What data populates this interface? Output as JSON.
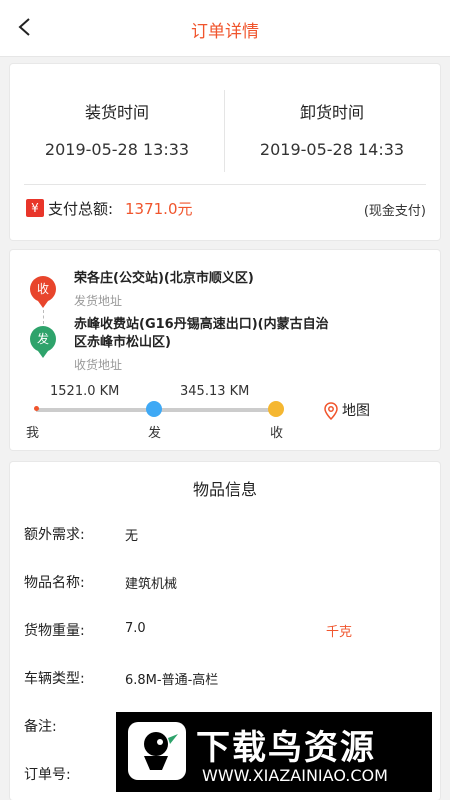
{
  "header": {
    "title": "订单详情"
  },
  "times": {
    "load_label": "装货时间",
    "load_value": "2019-05-28 13:33",
    "unload_label": "卸货时间",
    "unload_value": "2019-05-28 14:33"
  },
  "payment": {
    "icon": "¥",
    "label": "支付总额:",
    "amount": "1371.0元",
    "method": "(现金支付)"
  },
  "route": {
    "origin_pin": "收",
    "origin_name": "荣各庄(公交站)(北京市顺义区)",
    "origin_sub": "发货地址",
    "dest_pin": "发",
    "dest_name_line1": "赤峰收费站(G16丹锡高速出口)(内蒙古自治",
    "dest_name_line2": "区赤峰市松山区)",
    "dest_sub": "收货地址",
    "dist1": "1521.0 KM",
    "dist2": "345.13 KM",
    "label_me": "我",
    "label_fa": "发",
    "label_shou": "收",
    "map_label": "地图"
  },
  "goods": {
    "title": "物品信息",
    "extra_label": "额外需求:",
    "extra_value": "无",
    "name_label": "物品名称:",
    "name_value": "建筑机械",
    "weight_label": "货物重量:",
    "weight_value": "7.0",
    "weight_unit": "千克",
    "vehicle_label": "车辆类型:",
    "vehicle_value": "6.8M-普通-高栏",
    "note_label": "备注:",
    "order_label": "订单号:"
  },
  "watermark": {
    "big_text": "下载鸟资源",
    "url": "WWW.XIAZAINIAO.COM"
  },
  "colors": {
    "accent": "#f0552d",
    "red_pin": "#e8452c",
    "green_pin": "#2ea36b",
    "blue_dot": "#3fa9f5",
    "yellow_dot": "#f5b731"
  }
}
